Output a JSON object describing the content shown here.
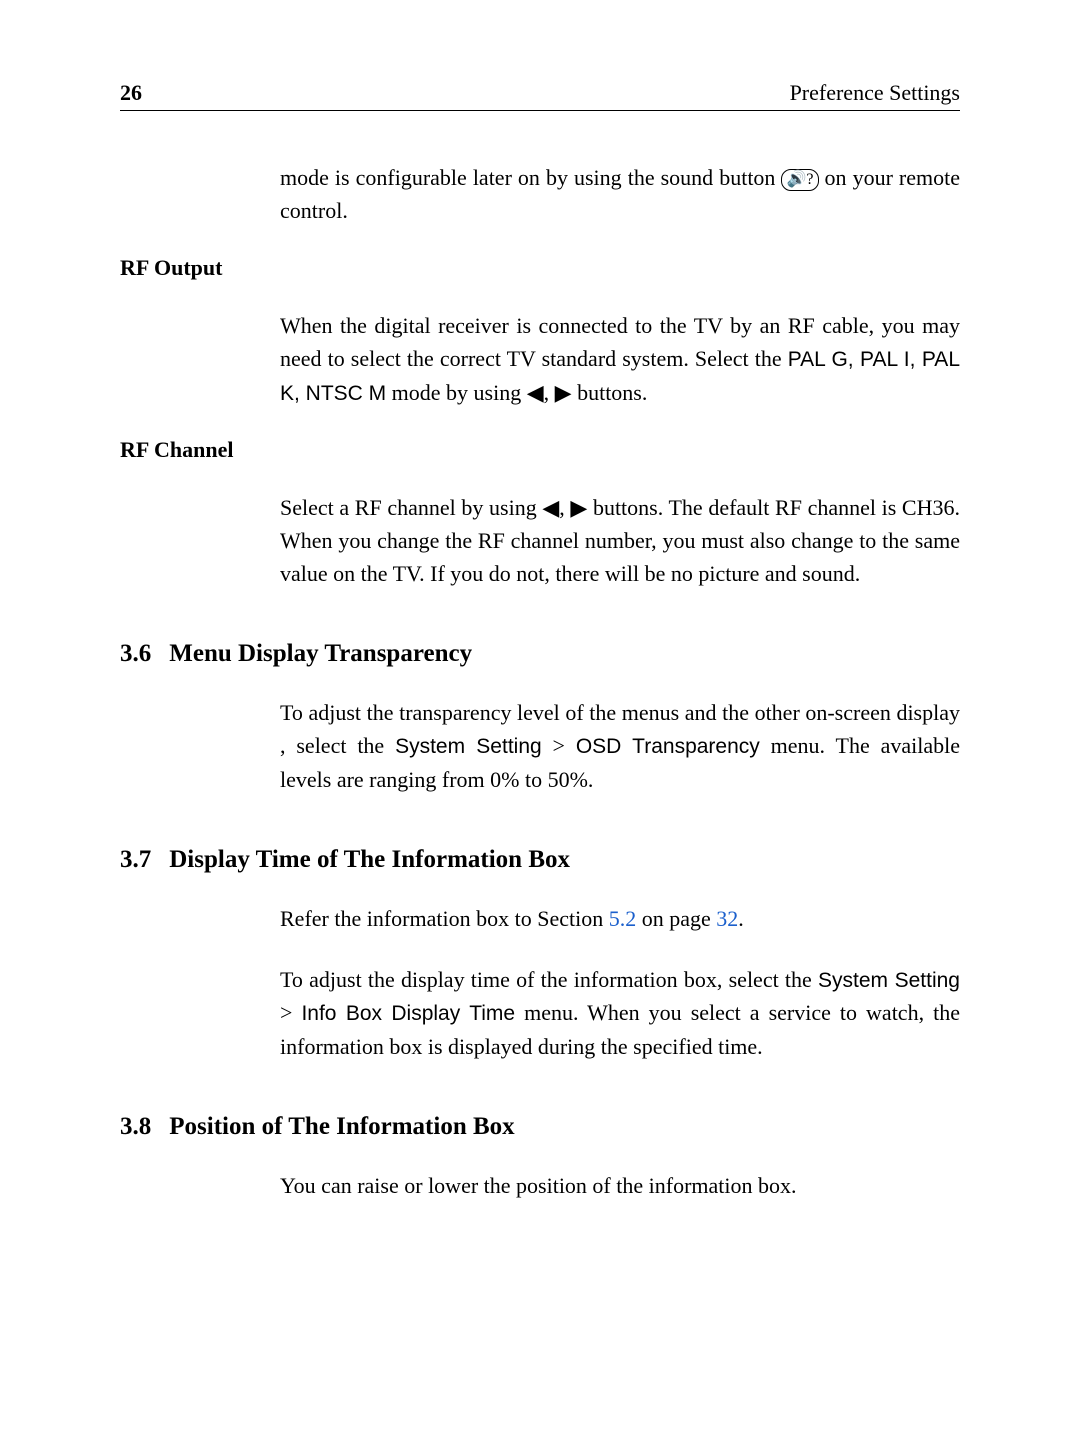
{
  "header": {
    "page_number": "26",
    "title": "Preference Settings"
  },
  "intro": {
    "text_before_icon": "mode is configurable later on by using the sound button ",
    "sound_icon_label": "🔊?",
    "text_after_icon": " on your remote control."
  },
  "rf_output": {
    "heading": "RF Output",
    "text_1": "When the digital receiver is connected to the TV by an RF cable, you may need to select the correct TV standard system. Select the ",
    "modes": "PAL G, PAL I, PAL K, NTSC M",
    "text_2": " mode by using ",
    "arrow_left": "◀",
    "arrow_sep": ", ",
    "arrow_right": "▶",
    "text_3": " buttons."
  },
  "rf_channel": {
    "heading": "RF Channel",
    "text_1": "Select a RF channel by using ",
    "arrow_left": "◀",
    "arrow_sep": ", ",
    "arrow_right": "▶",
    "text_2": " buttons. The default RF channel is CH36. When you change the RF channel number, you must also change to the same value on the TV. If you do not, there will be no picture and sound."
  },
  "section_3_6": {
    "number": "3.6",
    "title": "Menu Display Transparency",
    "text_1": "To adjust the transparency level of the menus and the other on-screen display , select the ",
    "menu_1": "System Setting",
    "gt": " > ",
    "menu_2": "OSD Transparency",
    "text_2": " menu. The available levels are ranging from 0% to 50%."
  },
  "section_3_7": {
    "number": "3.7",
    "title": "Display Time of The Information Box",
    "para1_1": "Refer the information box to Section ",
    "link_section": "5.2",
    "para1_2": " on page ",
    "link_page": "32",
    "para1_3": ".",
    "para2_1": "To adjust the display time of the information box, select the ",
    "menu_1": "System Setting",
    "gt": " > ",
    "menu_2": "Info Box Display Time",
    "para2_2": " menu. When you select a service to watch, the information box is displayed during the specified time."
  },
  "section_3_8": {
    "number": "3.8",
    "title": "Position of The Information Box",
    "text": "You can raise or lower the position of the information box."
  }
}
